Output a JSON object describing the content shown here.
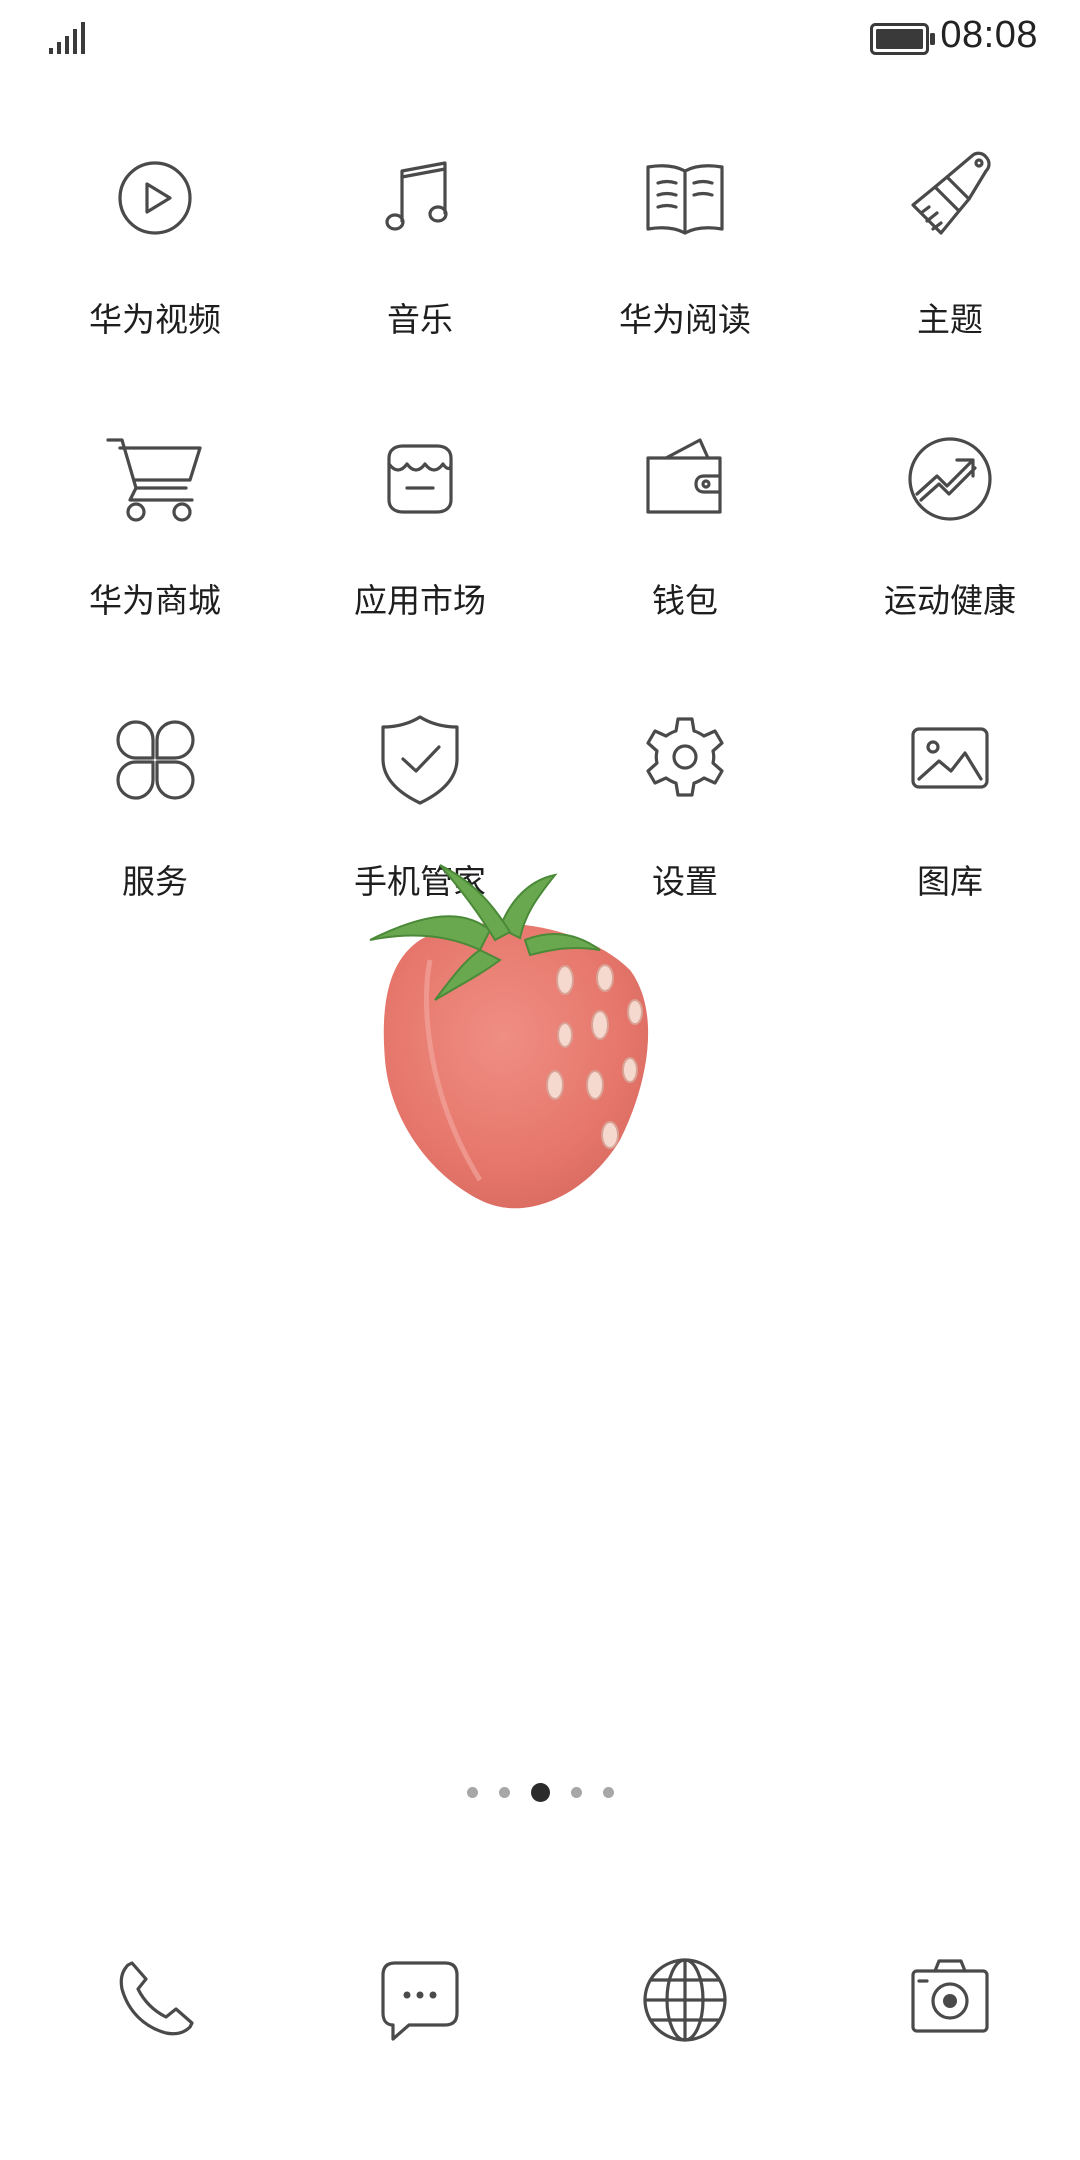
{
  "status_bar": {
    "time": "08:08",
    "signal_icon": "signal-bars-icon",
    "battery_icon": "battery-full-icon"
  },
  "apps": [
    {
      "label": "华为视频",
      "icon": "video-play-icon"
    },
    {
      "label": "音乐",
      "icon": "music-note-icon"
    },
    {
      "label": "华为阅读",
      "icon": "book-icon"
    },
    {
      "label": "主题",
      "icon": "paint-brush-icon"
    },
    {
      "label": "华为商城",
      "icon": "shopping-cart-icon"
    },
    {
      "label": "应用市场",
      "icon": "store-icon"
    },
    {
      "label": "钱包",
      "icon": "wallet-icon"
    },
    {
      "label": "运动健康",
      "icon": "health-trend-icon"
    },
    {
      "label": "服务",
      "icon": "clover-icon"
    },
    {
      "label": "手机管家",
      "icon": "shield-check-icon"
    },
    {
      "label": "设置",
      "icon": "gear-icon"
    },
    {
      "label": "图库",
      "icon": "gallery-icon"
    }
  ],
  "page_indicator": {
    "total": 5,
    "active_index": 2
  },
  "dock": [
    {
      "icon": "phone-icon"
    },
    {
      "icon": "message-bubble-icon"
    },
    {
      "icon": "globe-icon"
    },
    {
      "icon": "camera-icon"
    }
  ],
  "wallpaper": {
    "subject": "strawberry-illustration"
  },
  "colors": {
    "icon_stroke": "#4a4a4a",
    "strawberry_red": "#e8756a",
    "leaf_green": "#6aa84f"
  }
}
